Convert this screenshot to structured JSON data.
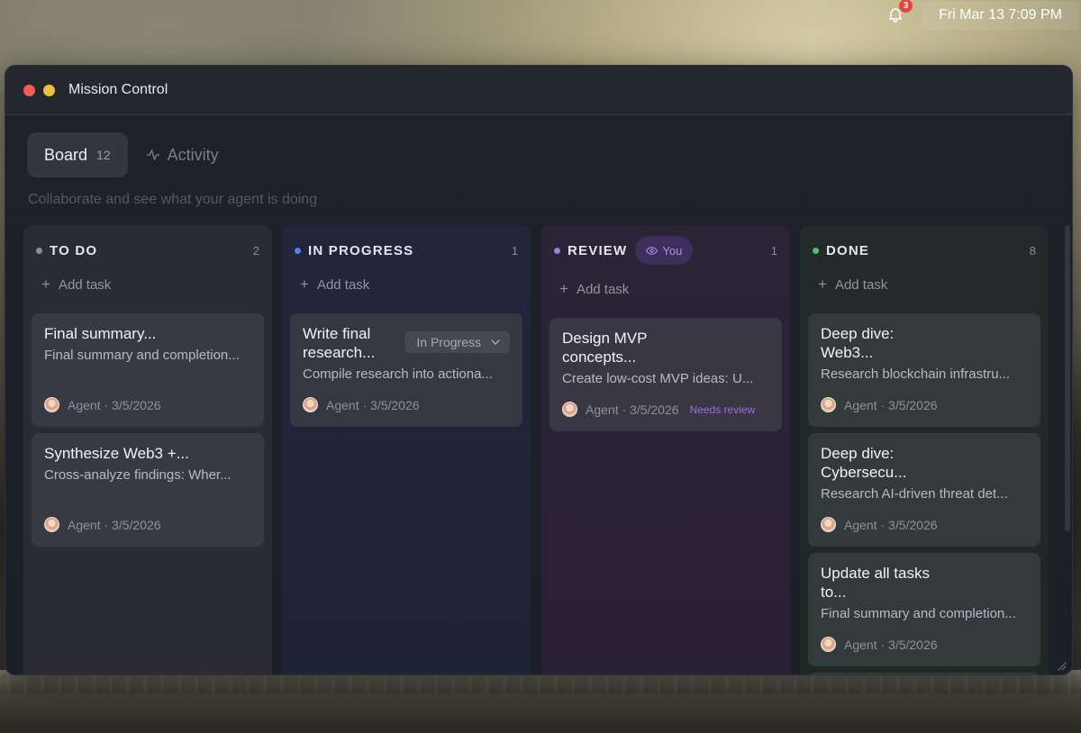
{
  "menubar": {
    "notification_count": "3",
    "clock": "Fri Mar 13  7:09 PM"
  },
  "window": {
    "title": "Mission Control"
  },
  "tabs": [
    {
      "label": "Board",
      "count": "12",
      "active": true
    },
    {
      "label": "Activity",
      "active": false
    }
  ],
  "subtitle": "Collaborate and see what your agent is doing",
  "columns": [
    {
      "title": "TO DO",
      "count": "2",
      "dot_color": "#8a8d98",
      "add_label": "Add task",
      "cards": [
        {
          "title": "Final summary...",
          "desc": "Final summary and completion...",
          "author": "Agent · 3/5/2026"
        },
        {
          "title": "Synthesize Web3 +...",
          "desc": "Cross-analyze findings: Wher...",
          "author": "Agent · 3/5/2026"
        }
      ]
    },
    {
      "title": "IN PROGRESS",
      "count": "1",
      "dot_color": "#5b7cf2",
      "add_label": "Add task",
      "cards": [
        {
          "title": "Write final research...",
          "desc": "Compile research into actiona...",
          "author": "Agent · 3/5/2026",
          "status": "In Progress"
        }
      ]
    },
    {
      "title": "REVIEW",
      "count": "1",
      "dot_color": "#a27ae0",
      "badge": "You",
      "add_label": "Add task",
      "cards": [
        {
          "title": "Design MVP concepts...",
          "desc": "Create low-cost MVP ideas: U...",
          "author": "Agent · 3/5/2026",
          "tag": "Needs review"
        }
      ]
    },
    {
      "title": "DONE",
      "count": "8",
      "dot_color": "#4ec06d",
      "add_label": "Add task",
      "cards": [
        {
          "title": "Deep dive: Web3...",
          "desc": "Research blockchain infrastru...",
          "author": "Agent · 3/5/2026"
        },
        {
          "title": "Deep dive: Cybersecu...",
          "desc": "Research AI-driven threat det...",
          "author": "Agent · 3/5/2026"
        },
        {
          "title": "Update all tasks to...",
          "desc": "Final summary and completion...",
          "author": "Agent · 3/5/2026"
        }
      ]
    }
  ]
}
